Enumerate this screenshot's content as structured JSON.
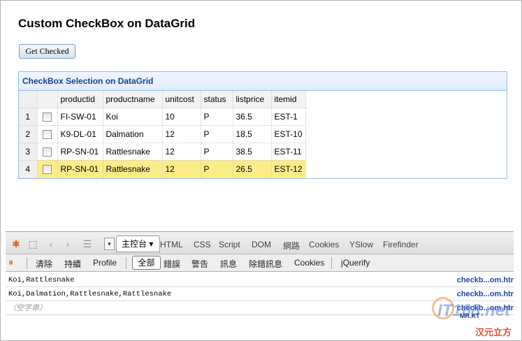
{
  "page": {
    "title": "Custom CheckBox on DataGrid",
    "get_checked_label": "Get Checked"
  },
  "grid": {
    "title": "CheckBox Selection on DataGrid",
    "columns": [
      "productid",
      "productname",
      "unitcost",
      "status",
      "listprice",
      "itemid"
    ],
    "rows": [
      {
        "num": "1",
        "productid": "FI-SW-01",
        "productname": "Koi",
        "unitcost": "10",
        "status": "P",
        "listprice": "36.5",
        "itemid": "EST-1",
        "selected": false
      },
      {
        "num": "2",
        "productid": "K9-DL-01",
        "productname": "Dalmation",
        "unitcost": "12",
        "status": "P",
        "listprice": "18.5",
        "itemid": "EST-10",
        "selected": false
      },
      {
        "num": "3",
        "productid": "RP-SN-01",
        "productname": "Rattlesnake",
        "unitcost": "12",
        "status": "P",
        "listprice": "38.5",
        "itemid": "EST-11",
        "selected": false
      },
      {
        "num": "4",
        "productid": "RP-SN-01",
        "productname": "Rattlesnake",
        "unitcost": "12",
        "status": "P",
        "listprice": "26.5",
        "itemid": "EST-12",
        "selected": true
      }
    ],
    "selected_row_color": "#fbec88",
    "header_text_color": "#15428b"
  },
  "firebug": {
    "console_tab": "主控台",
    "tabs": [
      "HTML",
      "CSS",
      "Script",
      "DOM",
      "網路",
      "Cookies",
      "YSlow",
      "Firefinder"
    ],
    "icons": [
      "firebug-icon",
      "inspect-icon",
      "back-icon",
      "forward-icon",
      "menu-icon"
    ],
    "subbar": {
      "clear": "清除",
      "persist": "持續",
      "profile": "Profile",
      "all": "全部",
      "errors": "錯誤",
      "warnings": "警告",
      "info": "訊息",
      "debug": "除錯訊息",
      "cookies": "Cookies",
      "jquerify": "jQuerify"
    },
    "log": [
      {
        "text": "Koi,Rattlesnake",
        "source": "checkb...om.htr"
      },
      {
        "text": "Koi,Dalmation,Rattlesnake,Rattlesnake",
        "source": "checkb...om.htr"
      },
      {
        "text": "（空字串）",
        "source": "checkb...om.htr"
      }
    ]
  },
  "watermark": {
    "brand": "IT168.net",
    "mark": "MR.KT",
    "sub": "汉元立方"
  }
}
